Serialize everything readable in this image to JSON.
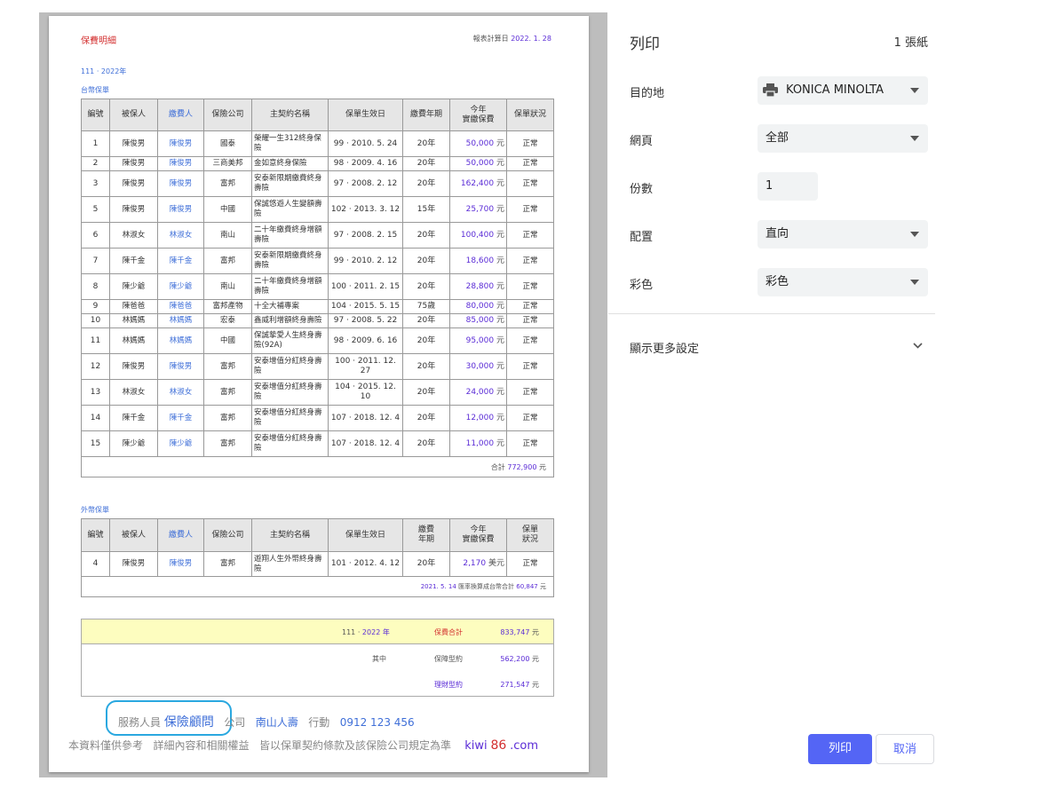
{
  "doc": {
    "title": "保費明細",
    "report_date_label": "報表計算日",
    "report_date": "2022. 1. 28",
    "year_roc": "111",
    "year_sep": "·",
    "year_ad": "2022年",
    "section_twd": "台幣保單",
    "section_foreign": "外幣保單"
  },
  "twd_headers": [
    "編號",
    "被保人",
    "繳費人",
    "保險公司",
    "主契約名稱",
    "保單生效日",
    "繳費年期",
    "今年\n實繳保費",
    "保單狀況"
  ],
  "twd_rows": [
    [
      "1",
      "陳俊男",
      "陳俊男",
      "國泰",
      "榮耀一生312終身保險",
      "99 ·  2010.  5. 24",
      "20年",
      "50,000",
      "正常"
    ],
    [
      "2",
      "陳俊男",
      "陳俊男",
      "三商美邦",
      "金如意終身保險",
      "98 ·  2009.  4. 16",
      "20年",
      "50,000",
      "正常"
    ],
    [
      "3",
      "陳俊男",
      "陳俊男",
      "富邦",
      "安泰新限期繳費終身壽險",
      "97 ·  2008.  2. 12",
      "20年",
      "162,400",
      "正常"
    ],
    [
      "5",
      "陳俊男",
      "陳俊男",
      "中國",
      "保誠悠遊人生變額壽險",
      "102 ·  2013.  3. 12",
      "15年",
      "25,700",
      "正常"
    ],
    [
      "6",
      "林淑女",
      "林淑女",
      "南山",
      "二十年繳費終身增額壽險",
      "97 ·  2008.  2. 15",
      "20年",
      "100,400",
      "正常"
    ],
    [
      "7",
      "陳千金",
      "陳千金",
      "富邦",
      "安泰新限期繳費終身壽險",
      "99 ·  2010.  2. 12",
      "20年",
      "18,600",
      "正常"
    ],
    [
      "8",
      "陳少爺",
      "陳少爺",
      "南山",
      "二十年繳費終身增額壽險",
      "100 ·  2011.  2. 15",
      "20年",
      "28,800",
      "正常"
    ],
    [
      "9",
      "陳爸爸",
      "陳爸爸",
      "富邦產物",
      "十全大補專案",
      "104 ·  2015.  5. 15",
      "75歲",
      "80,000",
      "正常"
    ],
    [
      "10",
      "林媽媽",
      "林媽媽",
      "宏泰",
      "鑫威利增額終身壽險",
      "97 ·  2008.  5. 22",
      "20年",
      "85,000",
      "正常"
    ],
    [
      "11",
      "林媽媽",
      "林媽媽",
      "中國",
      "保誠摯愛人生終身壽險(92A)",
      "98 ·  2009.  6. 16",
      "20年",
      "95,000",
      "正常"
    ],
    [
      "12",
      "陳俊男",
      "陳俊男",
      "富邦",
      "安泰增值分紅終身壽險",
      "100 ·  2011. 12. 27",
      "20年",
      "30,000",
      "正常"
    ],
    [
      "13",
      "林淑女",
      "林淑女",
      "富邦",
      "安泰增值分紅終身壽險",
      "104 ·  2015. 12. 10",
      "20年",
      "24,000",
      "正常"
    ],
    [
      "14",
      "陳千金",
      "陳千金",
      "富邦",
      "安泰增值分紅終身壽險",
      "107 ·  2018. 12.  4",
      "20年",
      "12,000",
      "正常"
    ],
    [
      "15",
      "陳少爺",
      "陳少爺",
      "富邦",
      "安泰增值分紅終身壽險",
      "107 ·  2018. 12.  4",
      "20年",
      "11,000",
      "正常"
    ]
  ],
  "twd_unit": "元",
  "twd_total_label": "合計",
  "twd_total": "772,900",
  "foreign_headers": [
    "編號",
    "被保人",
    "繳費人",
    "保險公司",
    "主契約名稱",
    "保單生效日",
    "繳費\n年期",
    "今年\n實繳保費",
    "保單\n狀況"
  ],
  "foreign_rows": [
    [
      "4",
      "陳俊男",
      "陳俊男",
      "富邦",
      "遊翔人生外幣終身壽險",
      "101 ·  2012.  4. 12",
      "20年",
      "2,170",
      "正常"
    ]
  ],
  "foreign_unit": "美元",
  "foreign_note_date": "2021. 5. 14",
  "foreign_note_text": "匯率換算成台幣合計",
  "foreign_note_total": "60,847",
  "summary": {
    "year_roc": "111",
    "year_sep": "·",
    "year_ad": "2022",
    "year_suffix": "年",
    "total_label": "保費合計",
    "total": "833,747",
    "among_label": "其中",
    "protect_label": "保障型約",
    "protect": "562,200",
    "invest_label": "理財型約",
    "invest": "271,547"
  },
  "footer": {
    "staff_label": "服務人員",
    "staff_name": "保險顧問",
    "company_label": "公司",
    "company": "南山人壽",
    "mobile_label": "行動",
    "mobile": "0912 123 456",
    "disclaimer1": "本資料僅供參考",
    "disclaimer2": "詳細內容和相關權益",
    "disclaimer3": "皆以保單契約條款及該保險公司規定為準",
    "brand_a": "kiwi",
    "brand_b": "86",
    "brand_c": ".com"
  },
  "print": {
    "title": "列印",
    "sheets": "1 張紙",
    "dest_label": "目的地",
    "dest_value": "KONICA MINOLTA",
    "pages_label": "網頁",
    "pages_value": "全部",
    "copies_label": "份數",
    "copies_value": "1",
    "layout_label": "配置",
    "layout_value": "直向",
    "color_label": "彩色",
    "color_value": "彩色",
    "more_label": "顯示更多設定",
    "print_btn": "列印",
    "cancel_btn": "取消"
  }
}
